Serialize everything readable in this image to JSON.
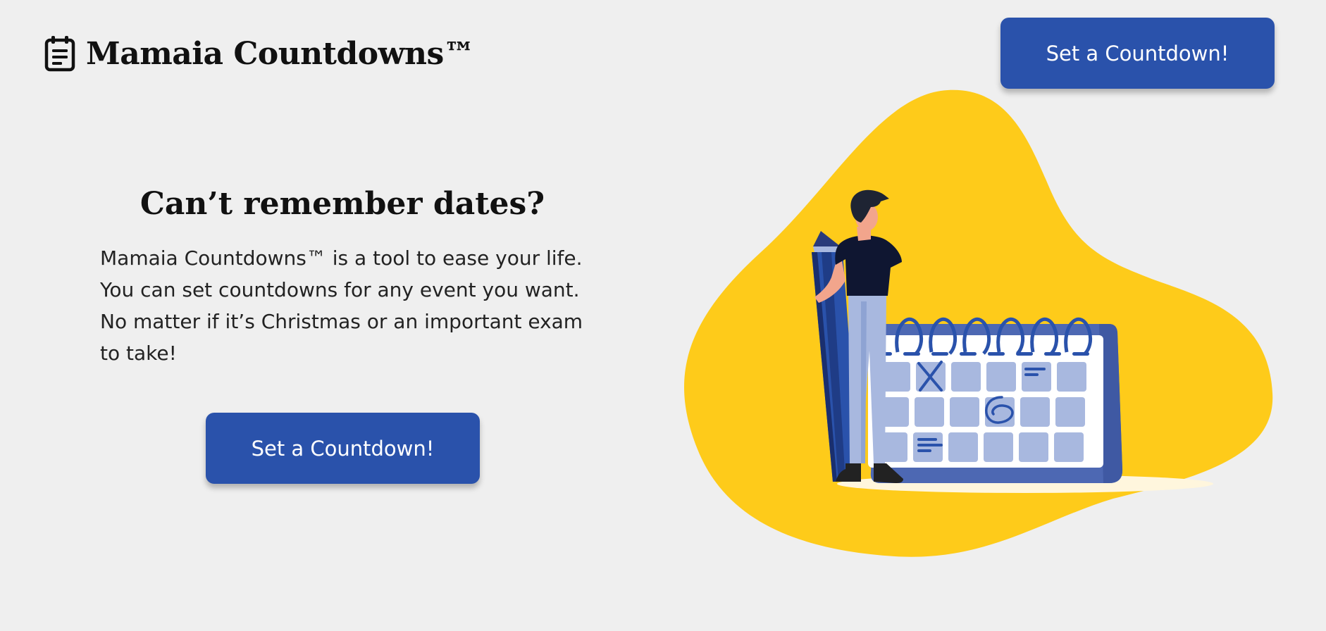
{
  "header": {
    "brand_title": "Mamaia Countdowns™",
    "brand_icon": "calendar-notes-icon",
    "cta_label": "Set a Countdown!"
  },
  "hero": {
    "title": "Can’t remember dates?",
    "description": "Mamaia Countdowns™ is a tool to ease your life. You can set countdowns for any event you want. No matter if it’s Christmas or an important exam to take!",
    "cta_label": "Set a Countdown!"
  },
  "illustration": {
    "subject": "person-with-pencil-and-calendar",
    "icons": [
      "pencil-icon",
      "calendar-icon"
    ]
  },
  "colors": {
    "background": "#efefef",
    "primary_button": "#2a52ab",
    "button_text": "#ffffff",
    "blob": "#fecb1a",
    "calendar_dark": "#4d68b3",
    "calendar_light": "#a8b8df",
    "shirt": "#0f1631"
  }
}
